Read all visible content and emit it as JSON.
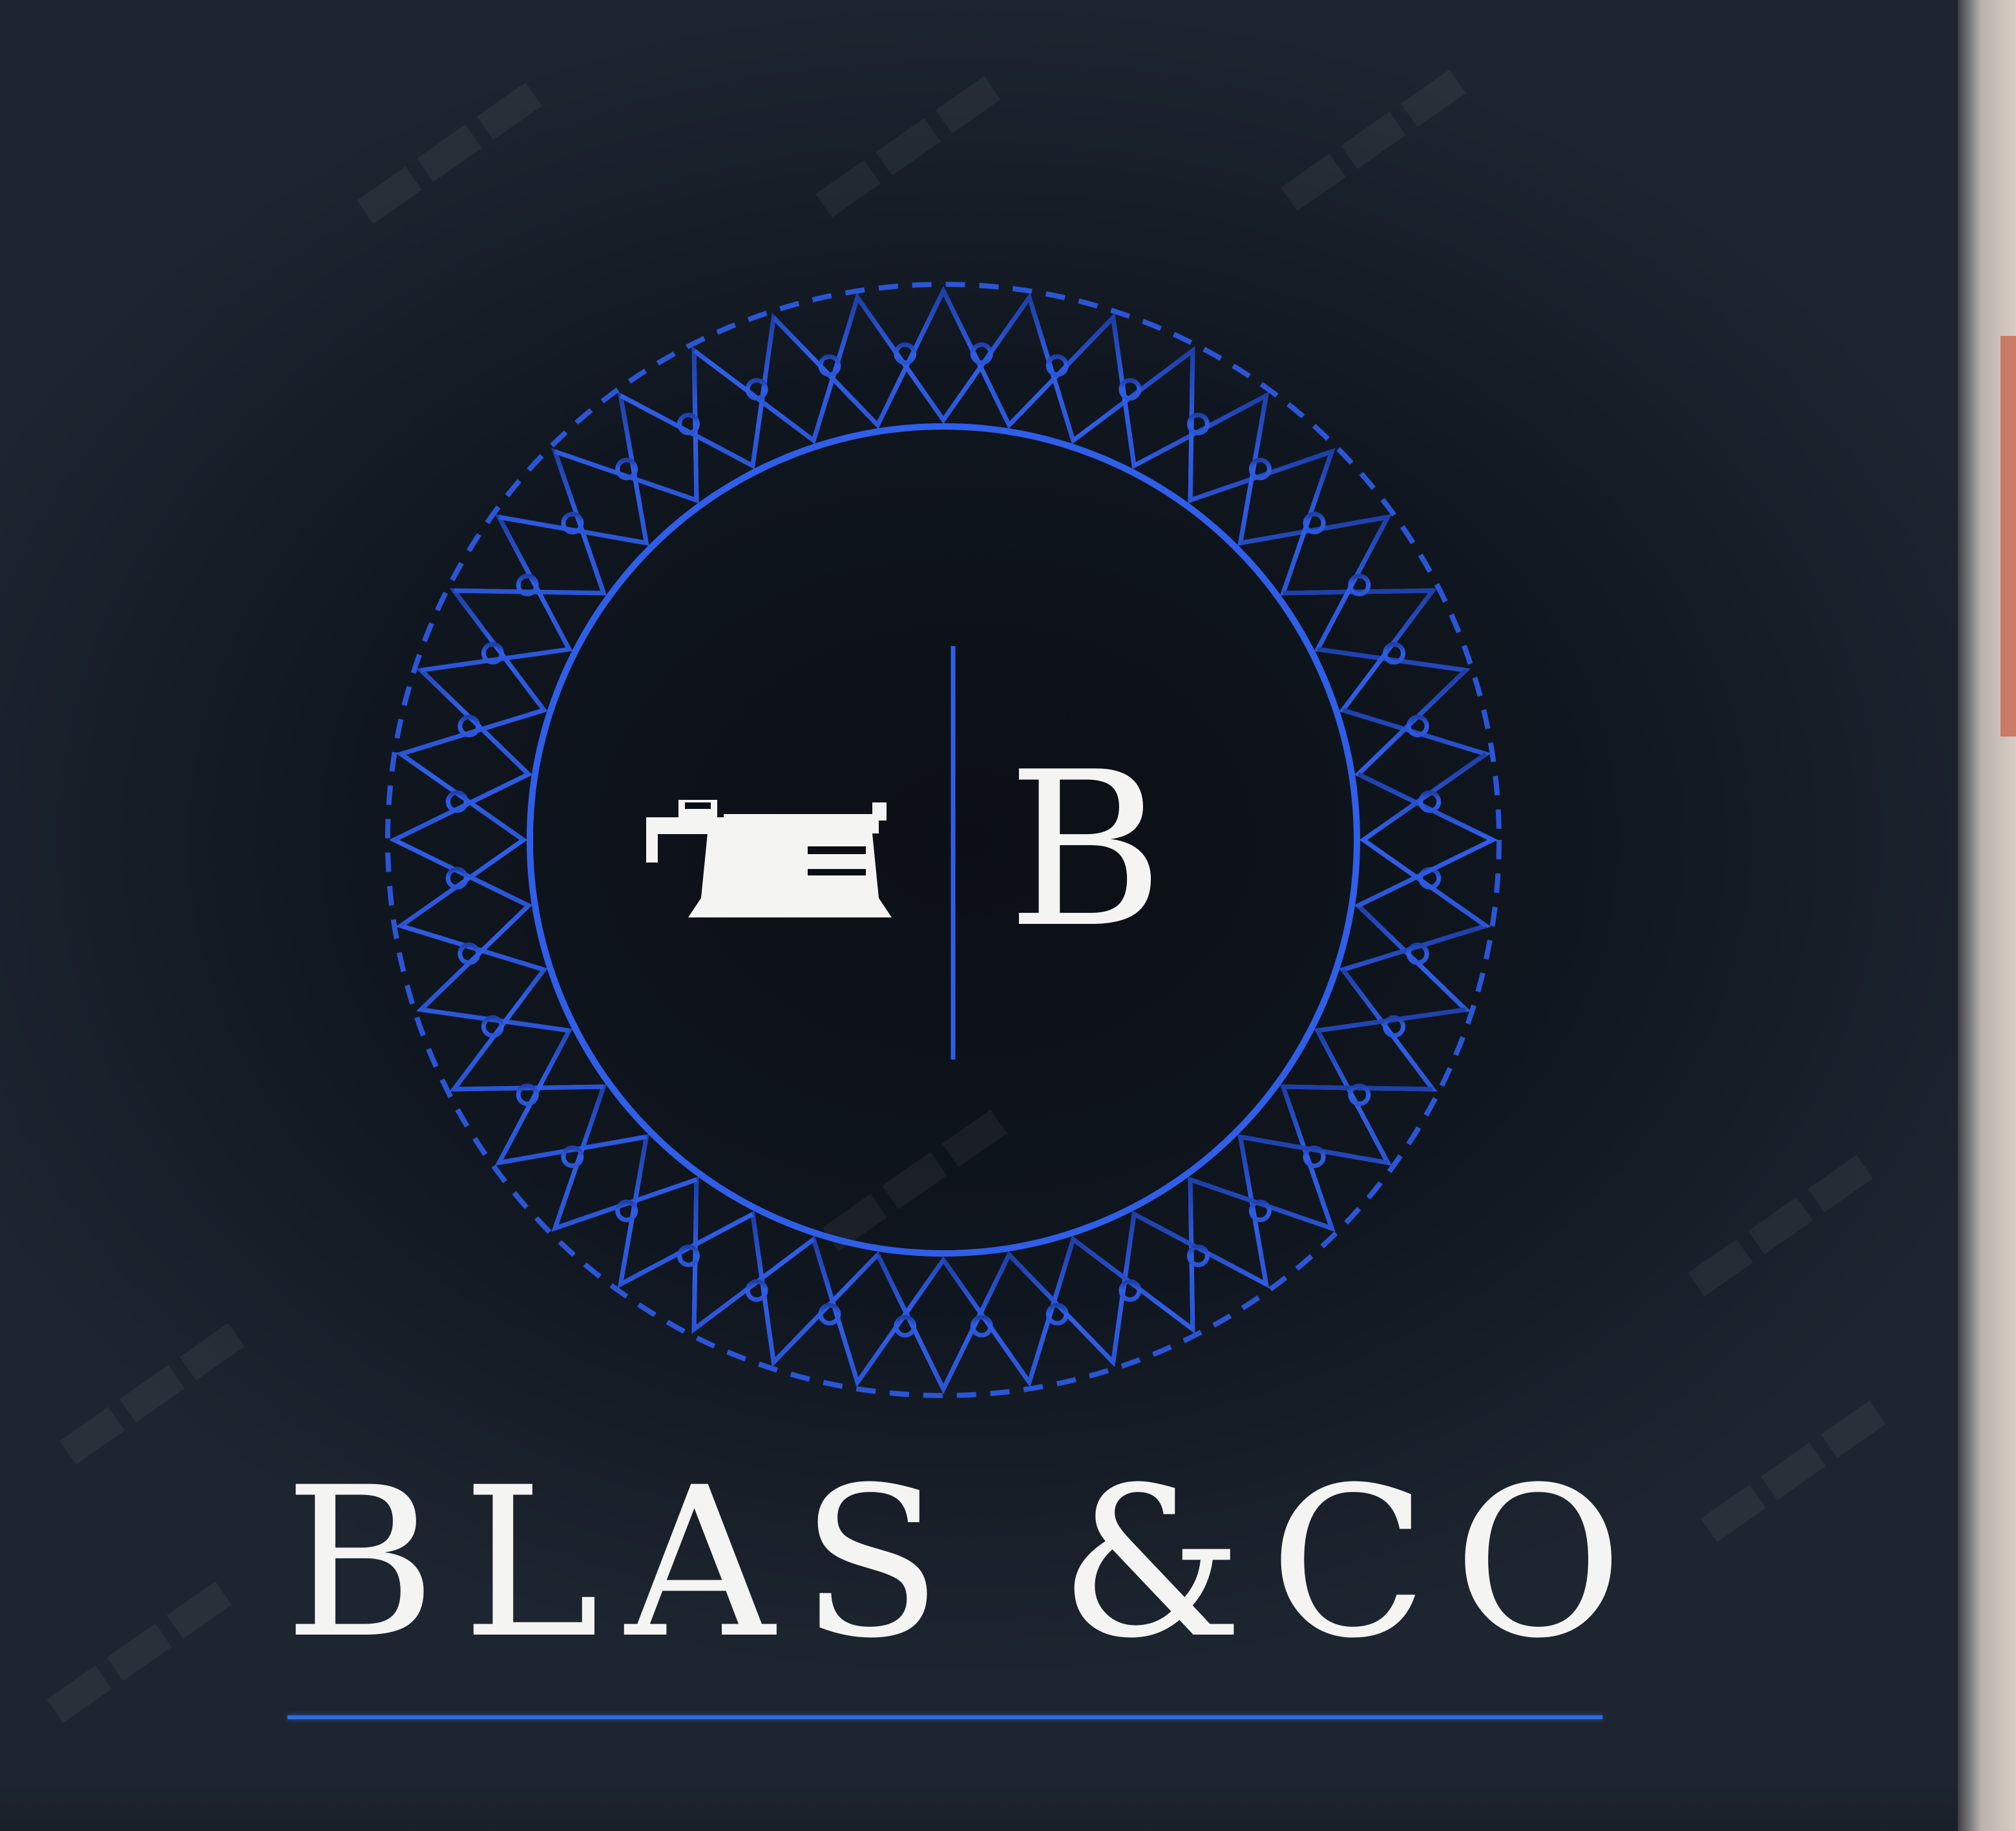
{
  "logo": {
    "monogram": "B",
    "name": "BLAS &CO",
    "icon": "sewing-machine-icon",
    "ring_color": "#2f5ee8",
    "text_color": "#f4f4f2",
    "background_color": "#0b0f15"
  }
}
